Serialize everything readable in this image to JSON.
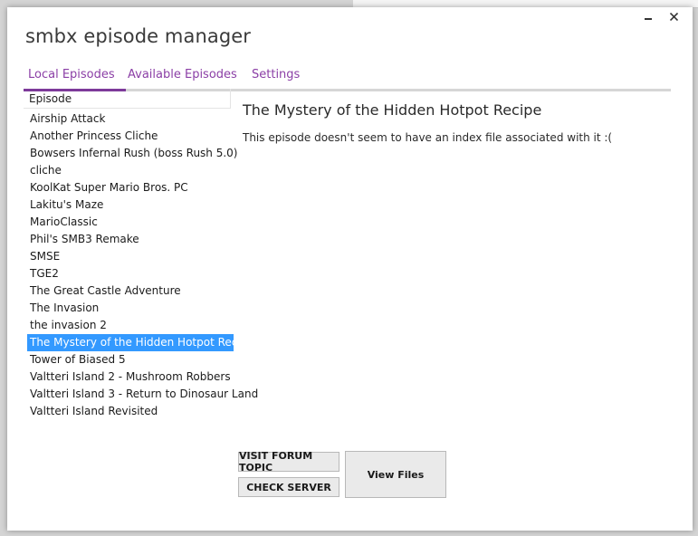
{
  "app": {
    "title": "smbx episode manager"
  },
  "tabs": [
    {
      "label": "Local Episodes",
      "active": true
    },
    {
      "label": "Available Episodes",
      "active": false
    },
    {
      "label": "Settings",
      "active": false
    }
  ],
  "episode_list": {
    "header": "Episode",
    "items": [
      "Airship Attack",
      "Another Princess Cliche",
      "Bowsers Infernal Rush (boss Rush 5.0)",
      "cliche",
      "KoolKat Super Mario Bros. PC",
      "Lakitu's Maze",
      "MarioClassic",
      "Phil's SMB3 Remake",
      "SMSE",
      "TGE2",
      "The Great Castle Adventure",
      "The Invasion",
      "the invasion 2",
      "The Mystery of the Hidden Hotpot Recipe",
      "Tower of Biased 5",
      "Valtteri Island 2 - Mushroom Robbers",
      "Valtteri Island 3 - Return to Dinosaur Land",
      "Valtteri Island Revisited"
    ],
    "selected_index": 13
  },
  "detail": {
    "title": "The Mystery of the Hidden Hotpot Recipe",
    "message": "This episode doesn't seem to have an index file associated with it :("
  },
  "buttons": {
    "visit_forum": "VISIT FORUM TOPIC",
    "check_server": "CHECK SERVER",
    "view_files": "View Files"
  },
  "colors": {
    "accent": "#7d3a9a",
    "tab_text": "#8b3fa6",
    "selection": "#3399ff"
  }
}
